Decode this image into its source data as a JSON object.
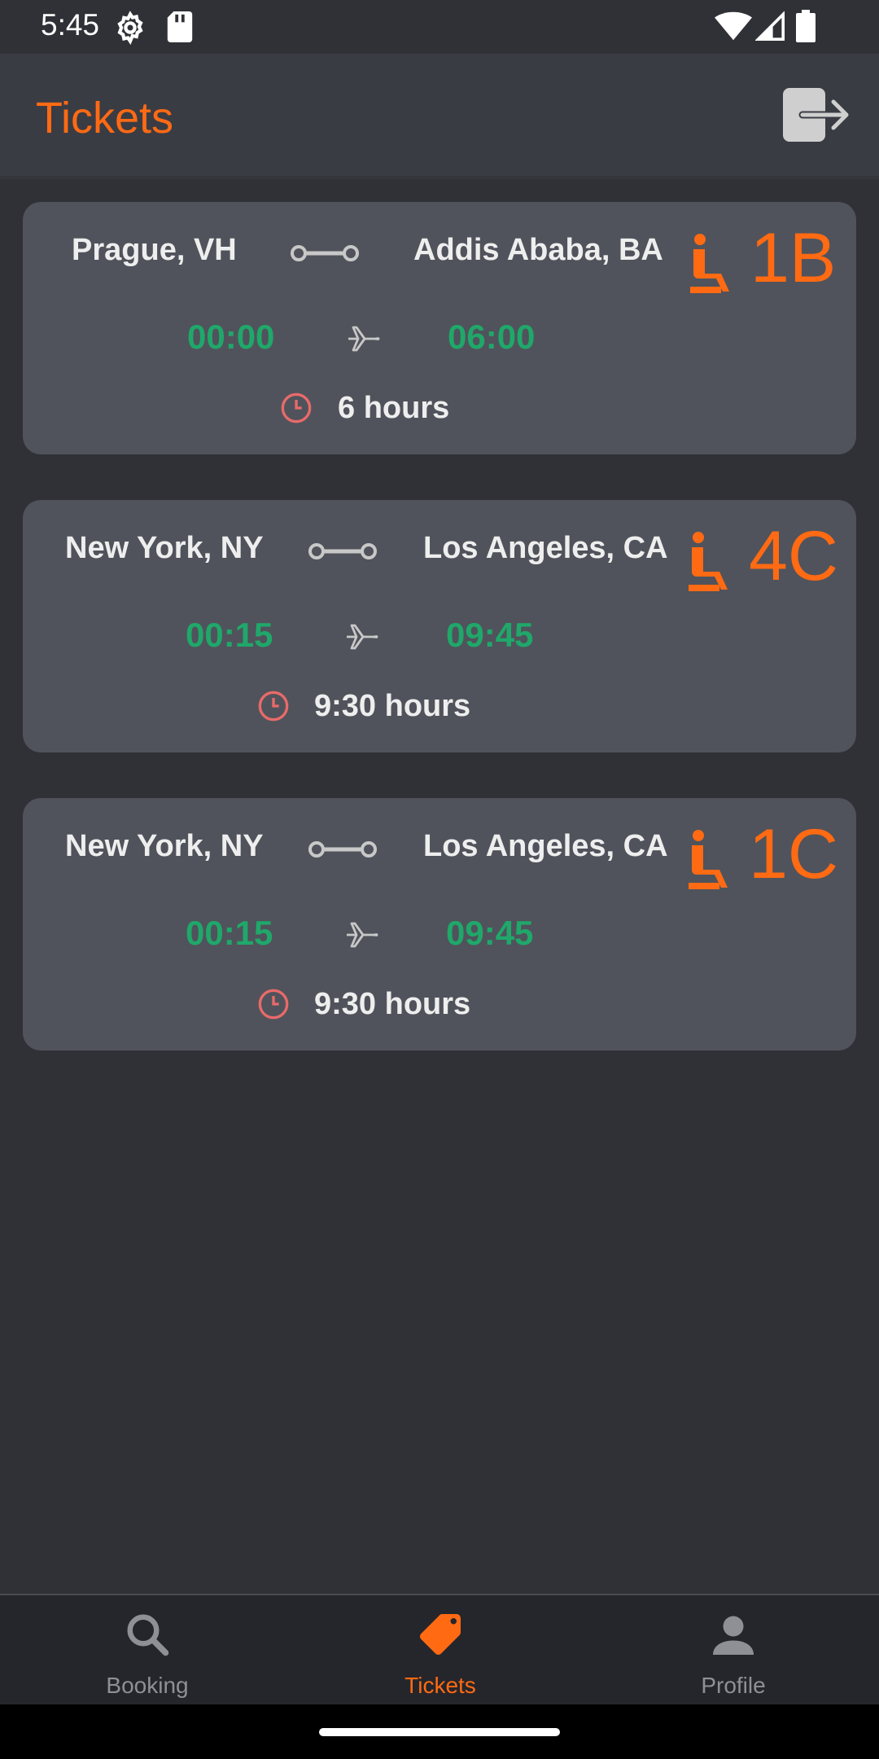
{
  "status_bar": {
    "time": "5:45"
  },
  "app_bar": {
    "title": "Tickets"
  },
  "tickets": [
    {
      "from": "Prague, VH",
      "to": "Addis Ababa, BA",
      "departure": "00:00",
      "arrival": "06:00",
      "duration": "6 hours",
      "seat": "1B"
    },
    {
      "from": "New York, NY",
      "to": "Los Angeles, CA",
      "departure": "00:15",
      "arrival": "09:45",
      "duration": "9:30 hours",
      "seat": "4C"
    },
    {
      "from": "New York, NY",
      "to": "Los Angeles, CA",
      "departure": "00:15",
      "arrival": "09:45",
      "duration": "9:30 hours",
      "seat": "1C"
    }
  ],
  "bottom_nav": {
    "items": [
      {
        "label": "Booking",
        "icon": "search-icon"
      },
      {
        "label": "Tickets",
        "icon": "tag-icon",
        "active": true
      },
      {
        "label": "Profile",
        "icon": "person-icon"
      }
    ]
  },
  "colors": {
    "accent": "#ff6a13",
    "time_green": "#1fa86a",
    "clock_red": "#e96a6a"
  }
}
